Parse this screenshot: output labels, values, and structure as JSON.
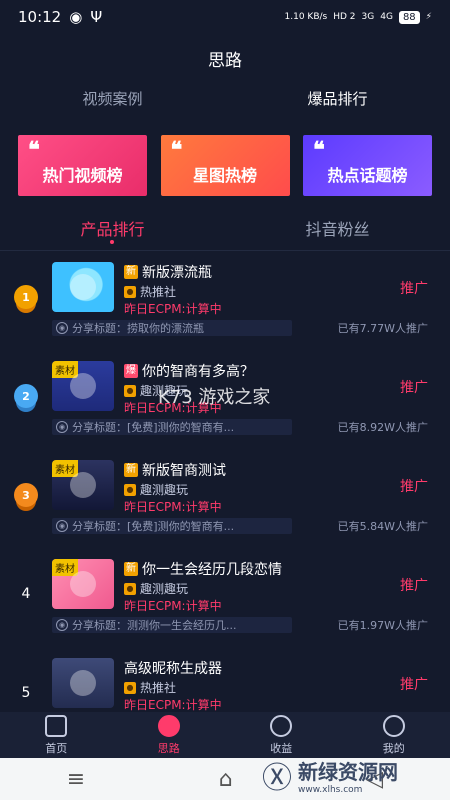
{
  "status": {
    "time": "10:12",
    "net_speed": "1.10 KB/s",
    "signal1": "HD 2",
    "signal2": "3G",
    "signal3": "4G",
    "battery": "88"
  },
  "page_title": "思路",
  "top_tabs": [
    {
      "label": "视频案例",
      "active": false
    },
    {
      "label": "爆品排行",
      "active": true
    }
  ],
  "banners": [
    {
      "label": "热门视频榜"
    },
    {
      "label": "星图热榜"
    },
    {
      "label": "热点话题榜"
    }
  ],
  "sub_tabs": [
    {
      "label": "产品排行",
      "active": true
    },
    {
      "label": "抖音粉丝",
      "active": false
    }
  ],
  "items": [
    {
      "rank": "1",
      "thumb_tag": "",
      "badge": "新",
      "name": "新版漂流瓶",
      "publisher": "热推社",
      "ecpm": "昨日ECPM:计算中",
      "share": "分享标题：捞取你的漂流瓶",
      "promoted": "已有7.77W人推广",
      "action": "推广"
    },
    {
      "rank": "2",
      "thumb_tag": "素材",
      "badge": "爆",
      "name": "你的智商有多高？",
      "publisher": "趣测趣玩",
      "ecpm": "昨日ECPM:计算中",
      "share": "分享标题：[免费]测你的智商有...",
      "promoted": "已有8.92W人推广",
      "action": "推广"
    },
    {
      "rank": "3",
      "thumb_tag": "素材",
      "badge": "新",
      "name": "新版智商测试",
      "publisher": "趣测趣玩",
      "ecpm": "昨日ECPM:计算中",
      "share": "分享标题：[免费]测你的智商有...",
      "promoted": "已有5.84W人推广",
      "action": "推广"
    },
    {
      "rank": "4",
      "thumb_tag": "素材",
      "badge": "新",
      "name": "你一生会经历几段恋情",
      "publisher": "趣测趣玩",
      "ecpm": "昨日ECPM:计算中",
      "share": "分享标题：测测你一生会经历几...",
      "promoted": "已有1.97W人推广",
      "action": "推广"
    },
    {
      "rank": "5",
      "thumb_tag": "",
      "badge": "",
      "name": "高级昵称生成器",
      "publisher": "热推社",
      "ecpm": "昨日ECPM:计算中",
      "share": "",
      "promoted": "",
      "action": "推广"
    }
  ],
  "nav": [
    {
      "label": "首页",
      "active": false
    },
    {
      "label": "思路",
      "active": true
    },
    {
      "label": "收益",
      "active": false
    },
    {
      "label": "我的",
      "active": false
    }
  ],
  "watermarks": {
    "k73": "K73 游戏之家",
    "xlhs_cn": "新绿资源网",
    "xlhs_url": "www.xlhs.com"
  },
  "colors": {
    "background": "#141a2c",
    "accent": "#ff3b6b"
  }
}
